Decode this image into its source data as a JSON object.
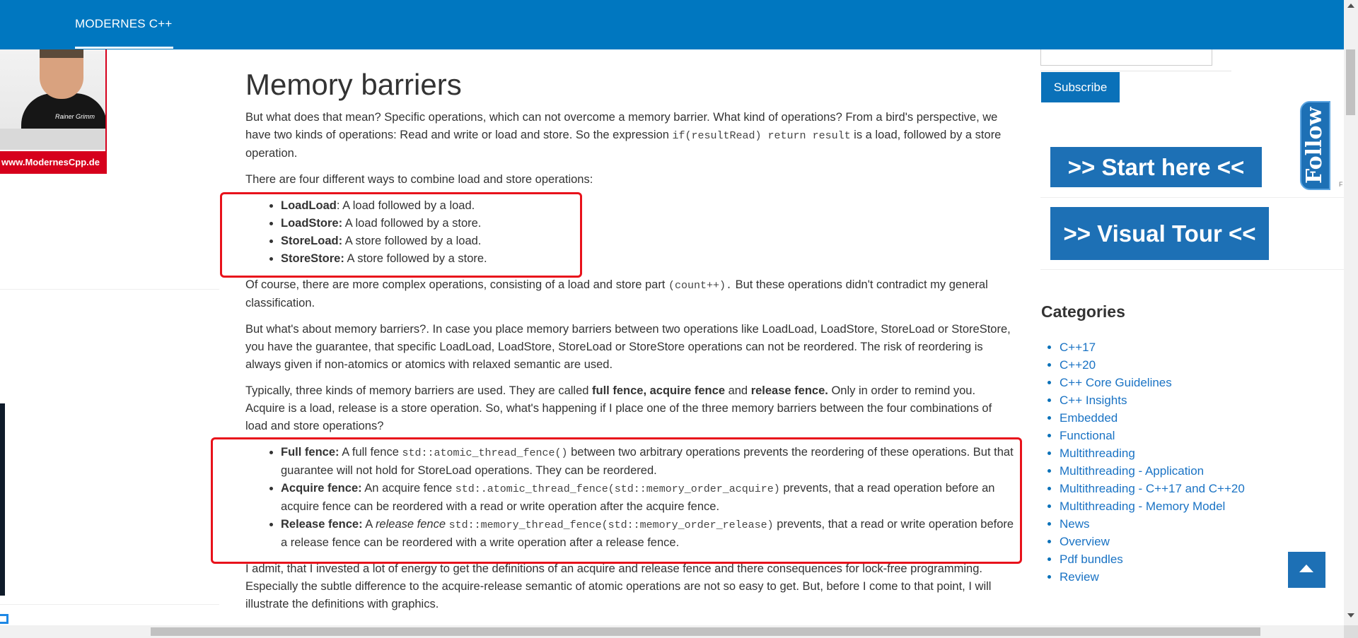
{
  "nav": {
    "item": "MODERNES C++"
  },
  "left_banner": {
    "photo_signature": "Rainer Grimm",
    "url_text": "www.ModernesCpp.de"
  },
  "article": {
    "title": "Memory barriers",
    "p1_a": "But what does that mean? Specific operations, which can not overcome a memory barrier. What kind of operations? From a bird's perspective, we have two kinds of operations: Read and write or load and store. So the expression ",
    "p1_code": "if(resultRead) return result",
    "p1_b": " is a load, followed by a store operation.",
    "p2": "There are four different ways to combine load and store operations:",
    "list1": [
      {
        "term": "LoadLoad",
        "desc": ": A load followed by a load."
      },
      {
        "term": "LoadStore:",
        "desc": " A load followed by a store."
      },
      {
        "term": "StoreLoad:",
        "desc": " A store followed by a load."
      },
      {
        "term": "StoreStore:",
        "desc": " A store followed by a store."
      }
    ],
    "p3_a": "Of course, there are more complex operations, consisting of a load and store part ",
    "p3_code": "(count++).",
    "p3_b": "  But these operations didn't contradict my general classification.",
    "p4": "But what's about memory barriers?. In case you place memory barriers between two operations like LoadLoad, LoadStore, StoreLoad or StoreStore, you have the guarantee, that specific LoadLoad, LoadStore, StoreLoad or StoreStore operations can not be reordered. The risk of reordering is always given if non-atomics or atomics with relaxed semantic are used.",
    "p5_a": "Typically, three kinds of memory barriers are used. They are called ",
    "p5_b1": "full fence, acquire fence",
    "p5_c": " and ",
    "p5_b2": "release fence.",
    "p5_d": " Only in order to remind you. Acquire is a load, release is a store operation. So, what's happening if I place one of the three memory barriers between the four combinations of load and store operations?",
    "fences": {
      "full_term": "Full fence:",
      "full_a": " A full fence ",
      "full_code": "std::atomic_thread_fence()",
      "full_b": " between two arbitrary operations prevents the reordering of these operations. But that guarantee will not hold for StoreLoad operations. They can be reordered.",
      "acq_term": "Acquire fence:",
      "acq_a": " An acquire fence ",
      "acq_code": "std:.atomic_thread_fence(std::memory_order_acquire)",
      "acq_b": " prevents, that a read operation before an acquire fence can be reordered with a read or write operation after the acquire fence.",
      "rel_term": "Release fence:",
      "rel_a": " A ",
      "rel_em": "release fence",
      "rel_sp": " ",
      "rel_code": "std::memory_thread_fence(std::memory_order_release)",
      "rel_b": " prevents, that a read or write operation before a release fence can be reordered with a write operation after a release fence."
    },
    "p6": "I admit, that I invested a lot of energy to get the definitions of an acquire and release fence and there consequences for lock-free programming. Especially the subtle difference to the acquire-release semantic of atomic operations are not so easy to get. But, before I come to that point, I will illustrate the definitions with graphics."
  },
  "sidebar": {
    "subscribe": "Subscribe",
    "start_here": ">> Start here <<",
    "visual_tour": ">> Visual Tour <<",
    "follow": "Follow",
    "tiny": "F",
    "categories_title": "Categories",
    "categories": [
      "C++17",
      "C++20",
      "C++ Core Guidelines",
      "C++ Insights",
      "Embedded",
      "Functional",
      "Multithreading",
      "Multithreading - Application",
      "Multithreading - C++17 and C++20",
      "Multithreading - Memory Model",
      "News",
      "Overview",
      "Pdf bundles",
      "Review"
    ]
  },
  "colors": {
    "brand_blue": "#0077c0",
    "highlight_red": "#e8121b",
    "link_blue": "#1a73c4"
  },
  "icons": {
    "back_to_top": "chevron-up-icon"
  }
}
